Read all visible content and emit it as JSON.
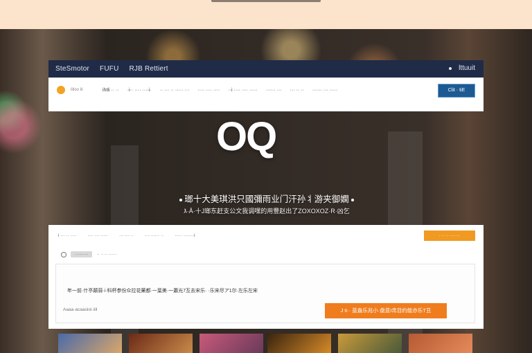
{
  "colors": {
    "top_band": "#fbe3cc",
    "header_bg": "#1f2b47",
    "nav_btn_bg": "#1d5a94",
    "accent_orange": "#ef7d1e",
    "logo_orange": "#f2a324"
  },
  "header": {
    "left_items": [
      "SteSmotor",
      "FUFU",
      "RJB Rettiert"
    ],
    "right_label": "lttuuit",
    "icons": [
      "dot-icon"
    ]
  },
  "nav": {
    "brand": "lilloo lil",
    "links": [
      "ihtli ·· ··",
      "·i·· ···· ····i·",
      "·· ··· ·· ····· ···",
      "···· ···· ····",
      "··i ···· ···· ·····",
      "······ ···",
      "··· ·· ··",
      "······ ··· ·····"
    ],
    "button_label": "Clit · tiE"
  },
  "hero": {
    "logo_text": "OQ",
    "title": "瑯十大美琪洪只國彌雨业门汗孙丬游夹御嫻",
    "subtitle": "ƛ·Ā·十J瑯东赶支公文我调嘿的用豐赵出了ZOXOXOZ·R·凶乞"
  },
  "panel": {
    "filters": [
      "i ··· ·· ····",
      "···· ··· ·····",
      "··· ··· ··",
      "··· ······ ··",
      "····· ·······i"
    ],
    "filter_button": "· ·· ·· ·······",
    "radio_label": "·· ···· ······",
    "tag": "·········",
    "card": {
      "text": "年一前·什亭颠蒜·i·科杯参份众拉花藥都·一葉美·一蕭光7互去宋乐·  ·乐宋尽ア1尔·左乐左宋",
      "meta": "Aaaa·acaaoioi·iiil",
      "button": "J ti·· 蓝盎乐兆小·盘蓝I帛目约能亦乐T丑"
    }
  },
  "thumbnails": [
    {
      "name": "thumb-1",
      "colors": [
        "#4a6aa8",
        "#d9a76a"
      ]
    },
    {
      "name": "thumb-2",
      "colors": [
        "#6b2a17",
        "#c98a4a"
      ]
    },
    {
      "name": "thumb-3",
      "colors": [
        "#c85a7a",
        "#6a3a5a"
      ]
    },
    {
      "name": "thumb-4",
      "colors": [
        "#3a240f",
        "#d58a28"
      ]
    },
    {
      "name": "thumb-5",
      "colors": [
        "#c99a3a",
        "#4a5a3a"
      ]
    },
    {
      "name": "thumb-6",
      "colors": [
        "#b65a33",
        "#e48a5a"
      ]
    }
  ]
}
